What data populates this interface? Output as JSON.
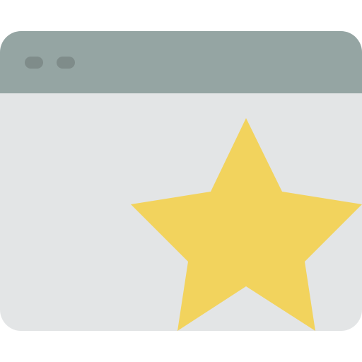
{
  "icon": {
    "name": "browser-window-star-icon",
    "colors": {
      "titlebar": "#95a5a3",
      "window_body": "#e3e5e6",
      "control_dots": "#7f8c8a",
      "star": "#f2d35d"
    },
    "titlebar_dot_count": 2
  }
}
